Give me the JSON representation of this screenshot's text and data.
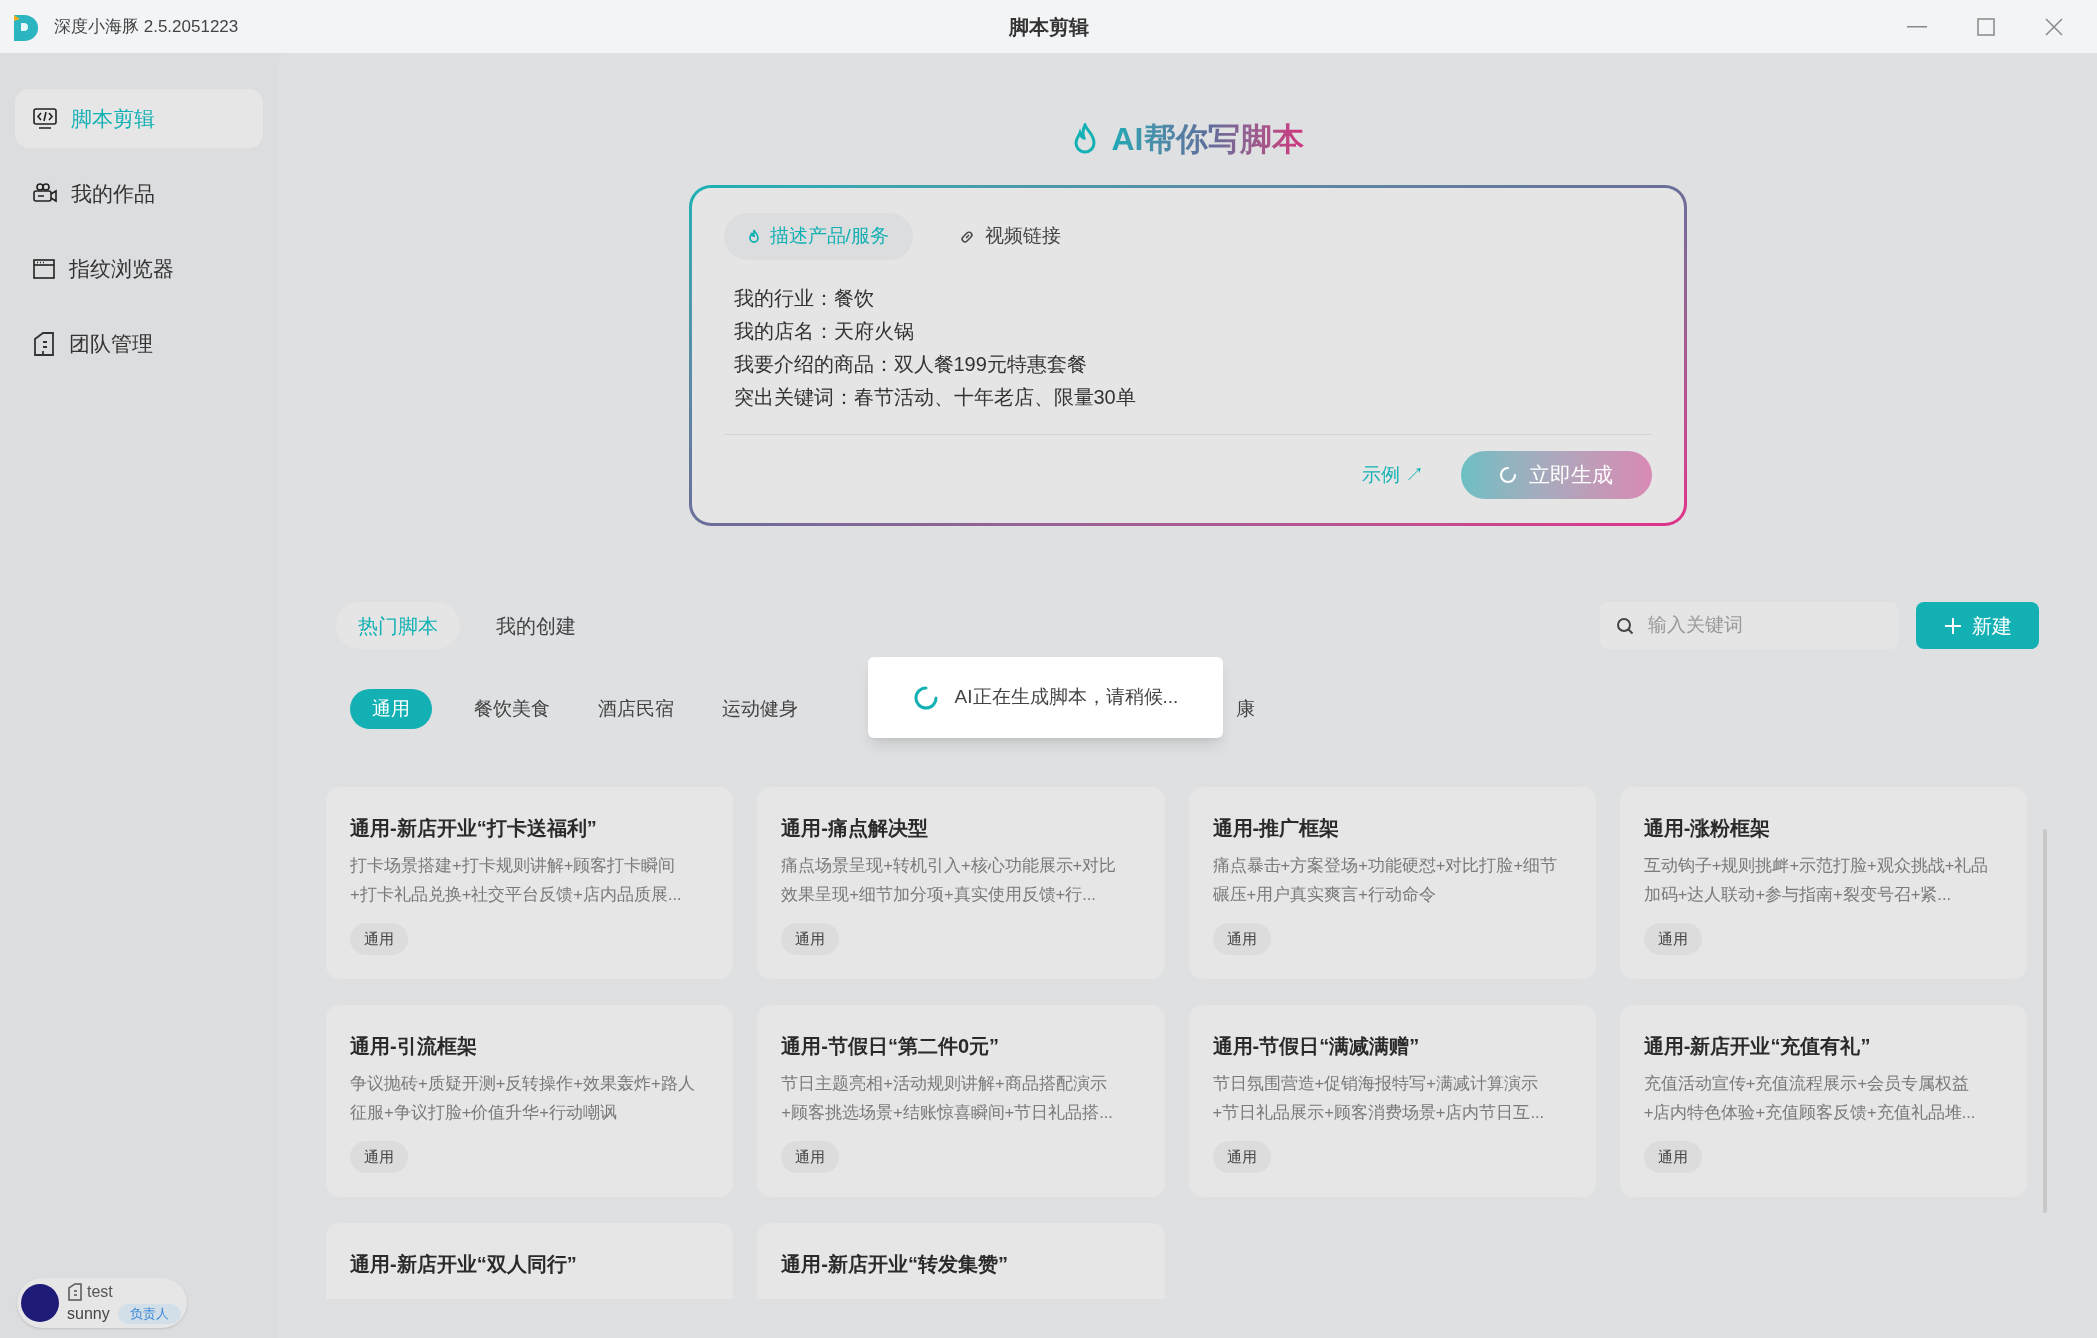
{
  "window": {
    "app_title": "深度小海豚 2.5.2051223",
    "title": "脚本剪辑"
  },
  "sidebar": {
    "items": [
      {
        "label": "脚本剪辑",
        "kind": "code",
        "selected": true
      },
      {
        "label": "我的作品",
        "kind": "camera",
        "selected": false
      },
      {
        "label": "指纹浏览器",
        "kind": "browser",
        "selected": false
      },
      {
        "label": "团队管理",
        "kind": "team",
        "selected": false
      }
    ],
    "user": {
      "team": "test",
      "name": "sunny",
      "role": "负责人"
    }
  },
  "generator": {
    "heading": "AI帮你写脚本",
    "tabs": [
      {
        "label": "描述产品/服务",
        "kind": "flame",
        "selected": true
      },
      {
        "label": "视频链接",
        "kind": "link",
        "selected": false
      }
    ],
    "lines": [
      "我的行业：餐饮",
      "我的店名：天府火锅",
      "我要介绍的商品：双人餐199元特惠套餐",
      "突出关键词：春节活动、十年老店、限量30单"
    ],
    "example_link": "示例 ↗",
    "generate_button": {
      "label": "立即生成",
      "loading": true
    }
  },
  "library": {
    "tabs": [
      {
        "label": "热门脚本",
        "selected": true
      },
      {
        "label": "我的创建",
        "selected": false
      }
    ],
    "search": {
      "placeholder": "输入关键词"
    },
    "new_button": "新建",
    "categories": [
      {
        "label": "通用",
        "selected": true,
        "kind": "full"
      },
      {
        "label": "餐饮美食",
        "selected": false,
        "kind": "full"
      },
      {
        "label": "酒店民宿",
        "selected": false,
        "kind": "full"
      },
      {
        "label": "运动健身",
        "selected": false,
        "kind": "full"
      },
      {
        "label": "康",
        "selected": false,
        "kind": "covered"
      }
    ],
    "cards": [
      {
        "title": "通用-新店开业“打卡送福利”",
        "description": "打卡场景搭建+打卡规则讲解+顾客打卡瞬间+打卡礼品兑换+社交平台反馈+店内品质展...",
        "tag": "通用"
      },
      {
        "title": "通用-痛点解决型",
        "description": "痛点场景呈现+转机引入+核心功能展示+对比效果呈现+细节加分项+真实使用反馈+行...",
        "tag": "通用"
      },
      {
        "title": "通用-推广框架",
        "description": "痛点暴击+方案登场+功能硬怼+对比打脸+细节碾压+用户真实爽言+行动命令",
        "tag": "通用"
      },
      {
        "title": "通用-涨粉框架",
        "description": "互动钩子+规则挑衅+示范打脸+观众挑战+礼品加码+达人联动+参与指南+裂变号召+紧...",
        "tag": "通用"
      },
      {
        "title": "通用-引流框架",
        "description": "争议抛砖+质疑开测+反转操作+效果轰炸+路人征服+争议打脸+价值升华+行动嘲讽",
        "tag": "通用"
      },
      {
        "title": "通用-节假日“第二件0元”",
        "description": "节日主题亮相+活动规则讲解+商品搭配演示+顾客挑选场景+结账惊喜瞬间+节日礼品搭...",
        "tag": "通用"
      },
      {
        "title": "通用-节假日“满减满赠”",
        "description": "节日氛围营造+促销海报特写+满减计算演示+节日礼品展示+顾客消费场景+店内节日互...",
        "tag": "通用"
      },
      {
        "title": "通用-新店开业“充值有礼”",
        "description": "充值活动宣传+充值流程展示+会员专属权益+店内特色体验+充值顾客反馈+充值礼品堆...",
        "tag": "通用"
      },
      {
        "title": "通用-新店开业“双人同行”"
      },
      {
        "title": "通用-新店开业“转发集赞”"
      }
    ]
  },
  "toast": {
    "message": "AI正在生成脚本，请稍候..."
  }
}
